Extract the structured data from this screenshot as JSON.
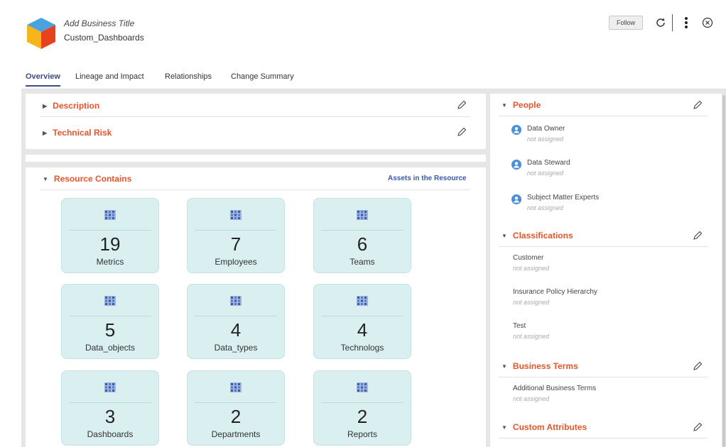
{
  "header": {
    "title": "Add Business Title",
    "subtitle": "Custom_Dashboards",
    "follow_label": "Follow"
  },
  "tabs": [
    {
      "label": "Overview",
      "active": true
    },
    {
      "label": "Lineage and Impact"
    },
    {
      "label": "Relationships"
    },
    {
      "label": "Change Summary"
    }
  ],
  "sections": {
    "description": "Description",
    "technical_risk": "Technical Risk",
    "resource_contains": "Resource Contains",
    "assets_link": "Assets in the Resource"
  },
  "tiles": [
    {
      "count": "19",
      "label": "Metrics"
    },
    {
      "count": "7",
      "label": "Employees"
    },
    {
      "count": "6",
      "label": "Teams"
    },
    {
      "count": "5",
      "label": "Data_objects"
    },
    {
      "count": "4",
      "label": "Data_types"
    },
    {
      "count": "4",
      "label": "Technologs"
    },
    {
      "count": "3",
      "label": "Dashboards"
    },
    {
      "count": "2",
      "label": "Departments"
    },
    {
      "count": "2",
      "label": "Reports"
    }
  ],
  "people": {
    "heading": "People",
    "roles": [
      {
        "name": "Data Owner",
        "value": "not assigned"
      },
      {
        "name": "Data Steward",
        "value": "not assigned"
      },
      {
        "name": "Subject Matter Experts",
        "value": "not assigned"
      }
    ]
  },
  "classifications": {
    "heading": "Classifications",
    "items": [
      {
        "name": "Customer",
        "value": "not assigned"
      },
      {
        "name": "Insurance Policy Hierarchy",
        "value": "not assigned"
      },
      {
        "name": "Test",
        "value": "not assigned"
      }
    ]
  },
  "business_terms": {
    "heading": "Business Terms",
    "items": [
      {
        "name": "Additional Business Terms",
        "value": "not assigned"
      }
    ]
  },
  "custom_attributes": {
    "heading": "Custom Attributes"
  },
  "colors": {
    "accent_orange": "#e8542b",
    "tab_active": "#3b4c8c",
    "tile_bg": "#d9eff0",
    "link_blue": "#3a5aa8",
    "person_blue": "#4a90d9"
  },
  "icons": {
    "refresh": "refresh-icon",
    "more": "more-vertical-icon",
    "close": "close-circle-icon",
    "edit": "pencil-icon",
    "person": "person-icon",
    "app": "cube-icon",
    "tile": "grid-icon"
  }
}
